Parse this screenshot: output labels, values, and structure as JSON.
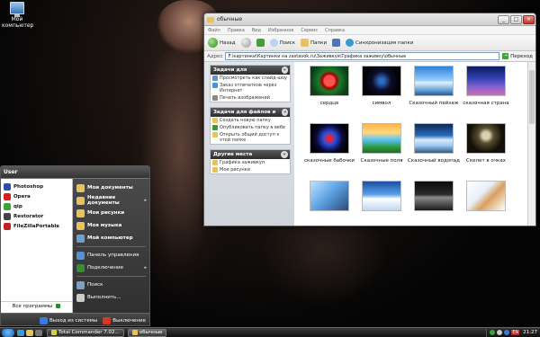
{
  "desktop": {
    "icons": [
      {
        "label_line1": "Мой",
        "label_line2": "компьютер",
        "icon": "computer-icon"
      }
    ]
  },
  "explorer": {
    "title": "обычные",
    "menu": [
      "Файл",
      "Правка",
      "Вид",
      "Избранное",
      "Сервис",
      "Справка"
    ],
    "toolbar": {
      "back": "Назад",
      "search": "Поиск",
      "folders": "Папки",
      "sync": "Синхронизация папки"
    },
    "address": {
      "label": "Адрес",
      "value": "F:\\картинки\\Картинки на zastavok.ru\\Заживкуя\\Графика заживку\\обычные",
      "go": "Переход"
    },
    "task_panels": [
      {
        "title": "Задачи для изображени",
        "items": [
          {
            "text": "Просмотреть как слайд-шоу",
            "icon_color": "#6a8fc6"
          },
          {
            "text": "Заказ отпечатков через Интернет",
            "icon_color": "#3a9ad8"
          },
          {
            "text": "Печать изображений",
            "icon_color": "#888888"
          }
        ]
      },
      {
        "title": "Задачи для файлов и папок",
        "items": [
          {
            "text": "Создать новую папку",
            "icon_color": "#e8c25a"
          },
          {
            "text": "Опубликовать папку в вебе",
            "icon_color": "#3a9a3a"
          },
          {
            "text": "Открыть общий доступ к этой папке",
            "icon_color": "#e8c25a"
          }
        ]
      },
      {
        "title": "Другие места",
        "items": [
          {
            "text": "Графика заживкуп",
            "icon_color": "#e8c25a"
          },
          {
            "text": "Мои рисунки",
            "icon_color": "#e8c25a"
          }
        ]
      }
    ],
    "files": [
      {
        "name": "сердце"
      },
      {
        "name": "символ"
      },
      {
        "name": "Сказочный пейзаж"
      },
      {
        "name": "сказочная страна"
      },
      {
        "name": "сказочные бабочки"
      },
      {
        "name": "Сказочные поля"
      },
      {
        "name": "Сказочный водопад"
      },
      {
        "name": "Скелет в очках"
      },
      {
        "name": ""
      },
      {
        "name": ""
      },
      {
        "name": ""
      },
      {
        "name": ""
      }
    ]
  },
  "start_menu": {
    "user": "User",
    "pinned": [
      {
        "label": "Photoshop",
        "color": "#2b4fa8"
      },
      {
        "label": "Opera",
        "color": "#d62020"
      },
      {
        "label": "qip",
        "color": "#3aa535"
      },
      {
        "label": "Restorator",
        "color": "#444444"
      },
      {
        "label": "FileZillaPortable",
        "color": "#c02020"
      }
    ],
    "all_programs": "Все программы",
    "places": [
      {
        "label": "Мои документы",
        "bold": true,
        "color": "#e8c25a",
        "arrow": ""
      },
      {
        "label": "Недавние документы",
        "bold": true,
        "color": "#e8c25a",
        "arrow": "▸"
      },
      {
        "label": "Мои рисунки",
        "bold": true,
        "color": "#e8c25a",
        "arrow": ""
      },
      {
        "label": "Моя музыка",
        "bold": true,
        "color": "#e8c25a",
        "arrow": ""
      },
      {
        "label": "Мой компьютер",
        "bold": true,
        "color": "#6a9fd8",
        "arrow": ""
      }
    ],
    "places2": [
      {
        "label": "Панель управления",
        "color": "#5a8fd0",
        "arrow": ""
      },
      {
        "label": "Подключение",
        "color": "#3a8a3a",
        "arrow": "▸"
      }
    ],
    "places3": [
      {
        "label": "Поиск",
        "color": "#7aa0d0",
        "arrow": ""
      },
      {
        "label": "Выполнить...",
        "color": "#cccccc",
        "arrow": ""
      }
    ],
    "logoff": "Выход из системы",
    "shutdown": "Выключение"
  },
  "taskbar": {
    "buttons": [
      {
        "label": "Total Commander 7.02...",
        "active": false
      },
      {
        "label": "обычные",
        "active": true
      }
    ],
    "lang": "EN",
    "clock": "21:27"
  }
}
